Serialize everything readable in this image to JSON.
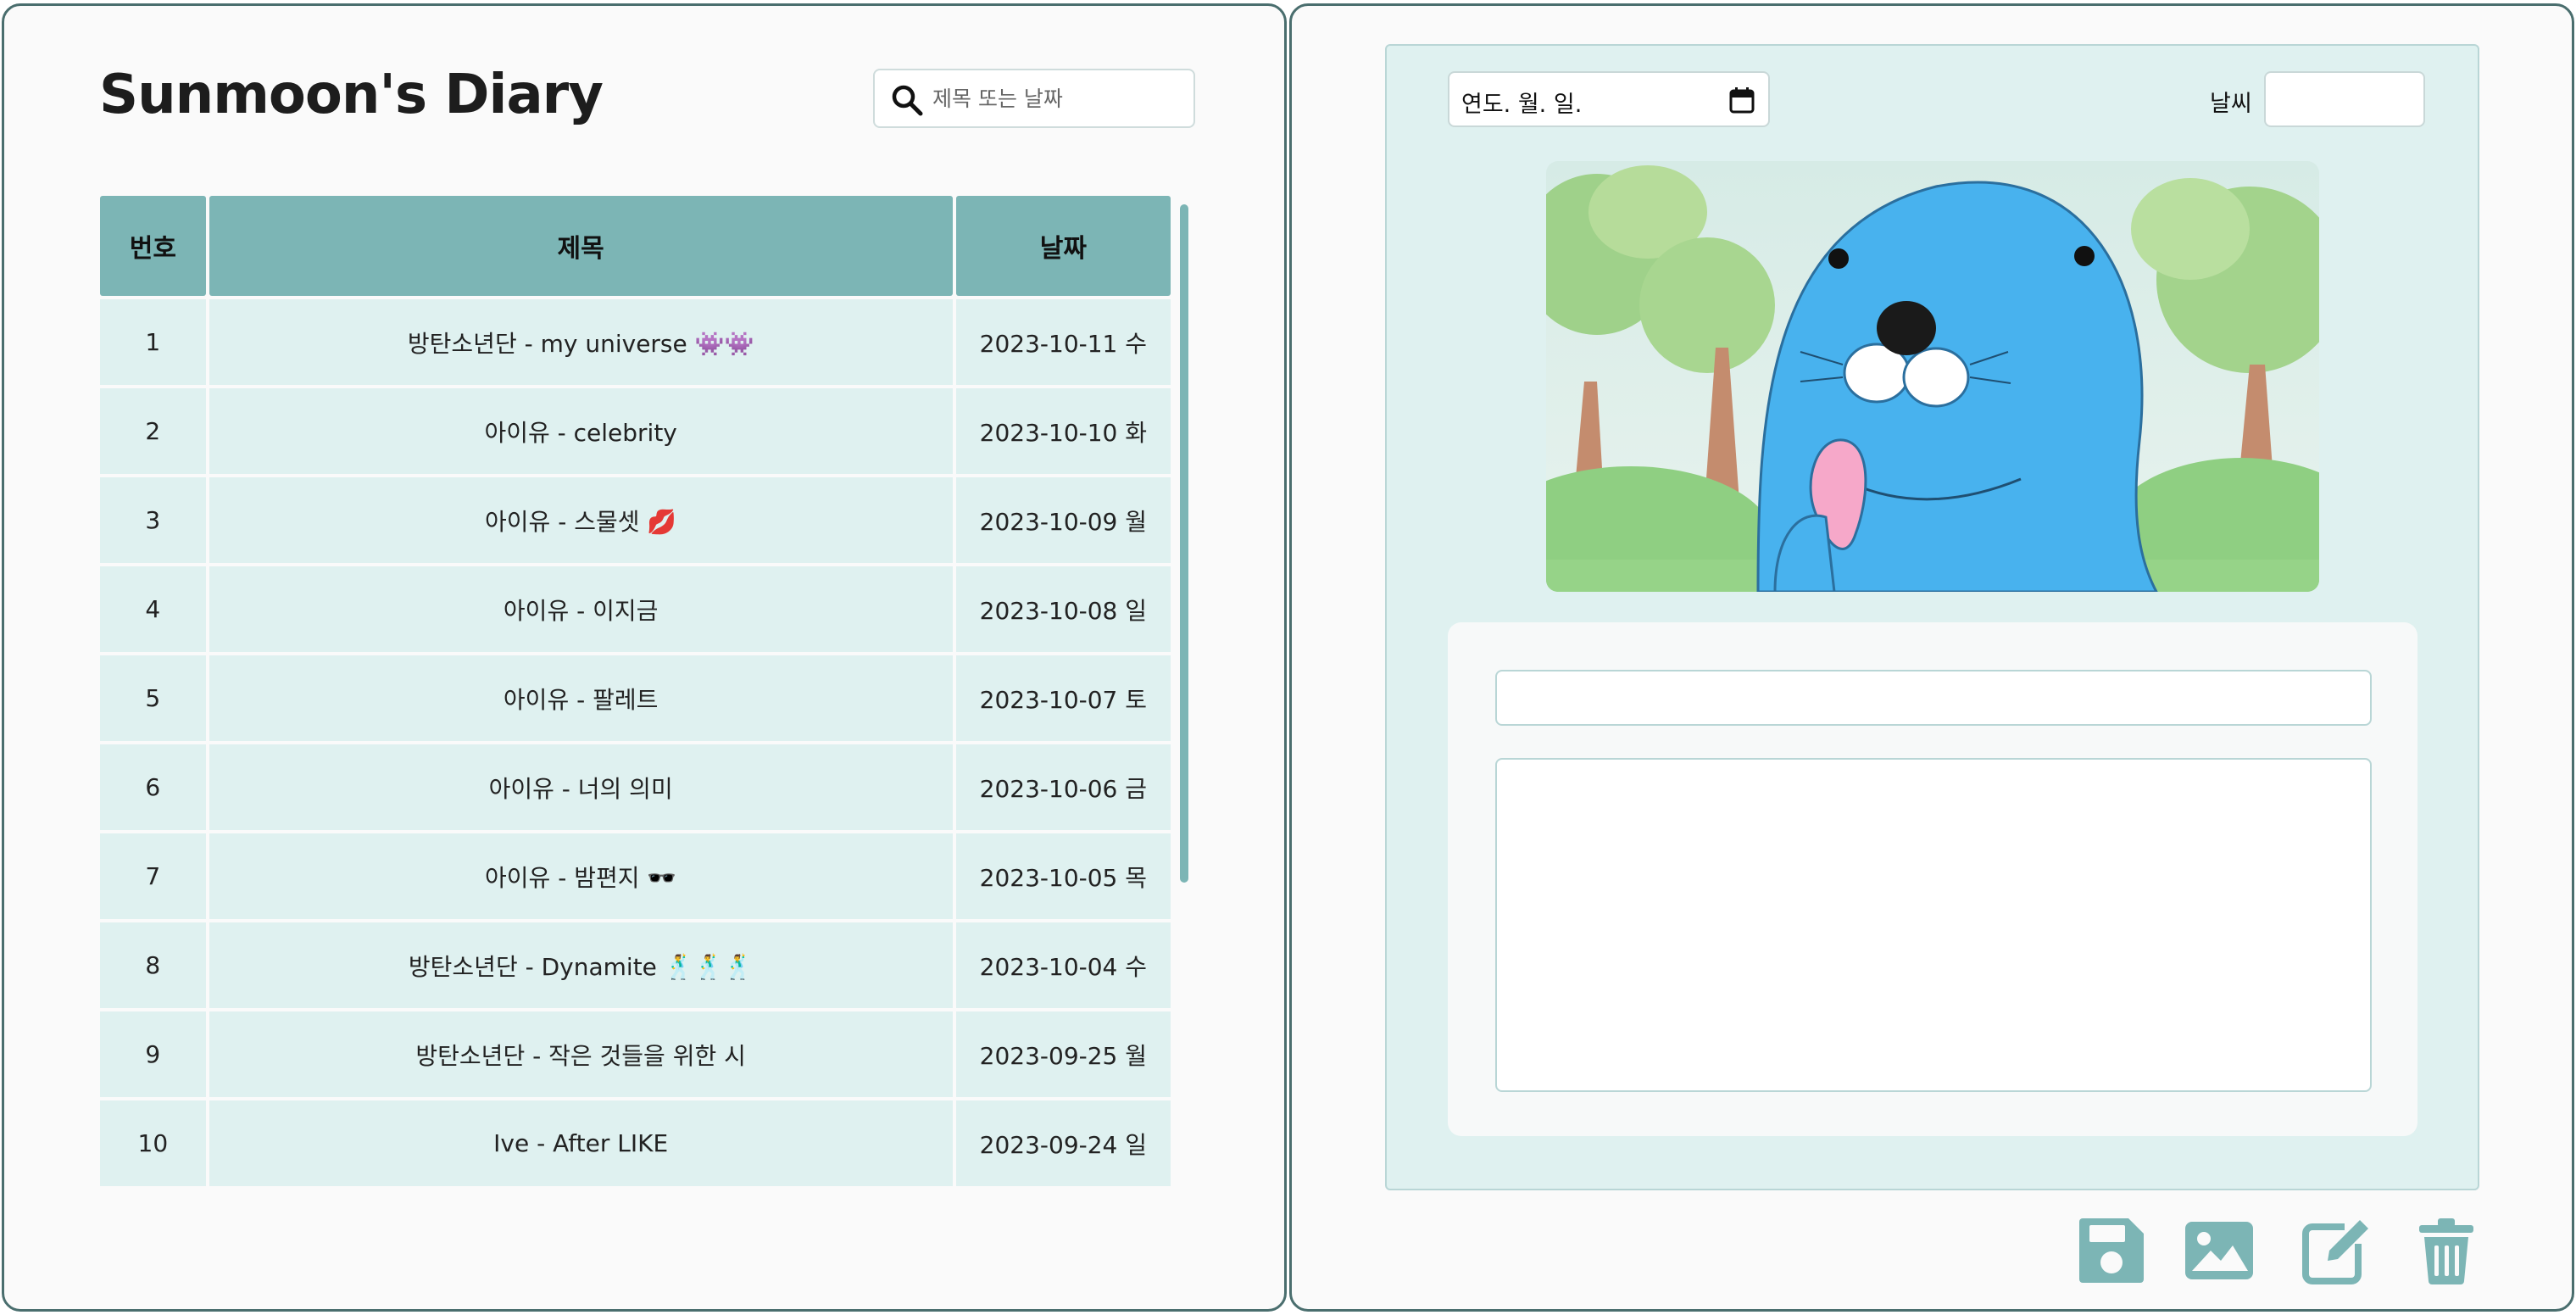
{
  "app": {
    "title": "Sunmoon's Diary"
  },
  "search": {
    "placeholder": "제목 또는 날짜",
    "icon": "search-icon"
  },
  "table": {
    "headers": {
      "no": "번호",
      "title": "제목",
      "date": "날짜"
    },
    "rows": [
      {
        "no": "1",
        "title": "방탄소년단 - my universe 👾👾",
        "date": "2023-10-11 수"
      },
      {
        "no": "2",
        "title": "아이유 - celebrity",
        "date": "2023-10-10 화"
      },
      {
        "no": "3",
        "title": "아이유 - 스물셋 💋",
        "date": "2023-10-09 월"
      },
      {
        "no": "4",
        "title": "아이유 - 이지금",
        "date": "2023-10-08 일"
      },
      {
        "no": "5",
        "title": "아이유 - 팔레트",
        "date": "2023-10-07 토"
      },
      {
        "no": "6",
        "title": "아이유 - 너의 의미",
        "date": "2023-10-06 금"
      },
      {
        "no": "7",
        "title": "아이유 - 밤편지 🕶️",
        "date": "2023-10-05 목"
      },
      {
        "no": "8",
        "title": "방탄소년단 - Dynamite 🕺🕺🕺",
        "date": "2023-10-04 수"
      },
      {
        "no": "9",
        "title": "방탄소년단 - 작은 것들을 위한 시",
        "date": "2023-09-25 월"
      },
      {
        "no": "10",
        "title": "Ive - After LIKE",
        "date": "2023-09-24 일"
      }
    ]
  },
  "editor": {
    "date_placeholder": "연도. 월. 일.",
    "weather_label": "날씨",
    "weather_value": "",
    "title_value": "",
    "content_value": ""
  },
  "toolbar": {
    "icons": [
      "save-icon",
      "image-icon",
      "edit-icon",
      "trash-icon"
    ]
  },
  "colors": {
    "accent": "#7cb5b5",
    "row_bg": "#dff1f0",
    "panel_border": "#4a6e6e"
  }
}
